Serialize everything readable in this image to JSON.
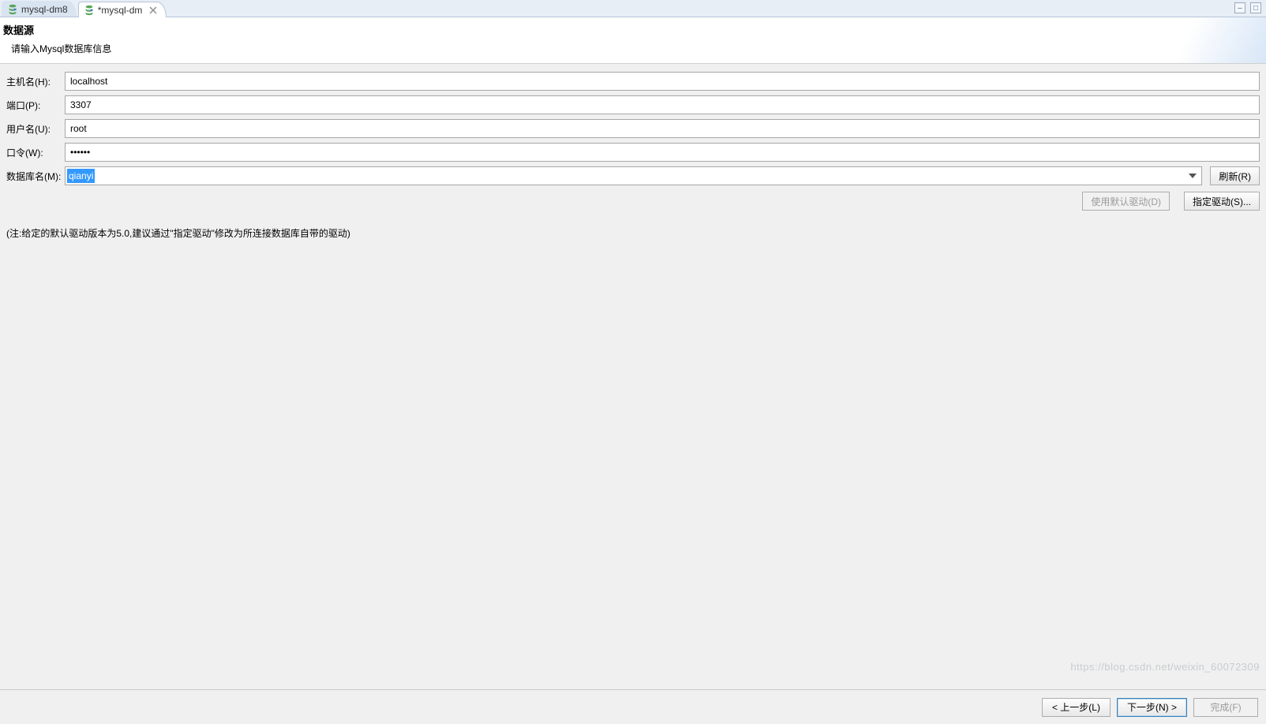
{
  "tabs": [
    {
      "label": "mysql-dm8",
      "active": false,
      "closable": false
    },
    {
      "label": "*mysql-dm",
      "active": true,
      "closable": true
    }
  ],
  "header": {
    "title": "数据源",
    "subtitle": "请输入Mysql数据库信息"
  },
  "form": {
    "host": {
      "label": "主机名(H):",
      "value": "localhost"
    },
    "port": {
      "label": "端口(P):",
      "value": "3307"
    },
    "user": {
      "label": "用户名(U):",
      "value": "root"
    },
    "password": {
      "label": "口令(W):",
      "value": "••••••"
    },
    "database": {
      "label": "数据库名(M):",
      "value": "qianyi"
    },
    "refresh_btn": "刷新(R)",
    "default_driver_btn": "使用默认驱动(D)",
    "specify_driver_btn": "指定驱动(S)..."
  },
  "note": "(注:给定的默认驱动版本为5.0,建议通过\"指定驱动\"修改为所连接数据库自带的驱动)",
  "footer": {
    "back": "< 上一步(L)",
    "next": "下一步(N) >",
    "finish": "完成(F)"
  },
  "watermark": "https://blog.csdn.net/weixin_60072309"
}
